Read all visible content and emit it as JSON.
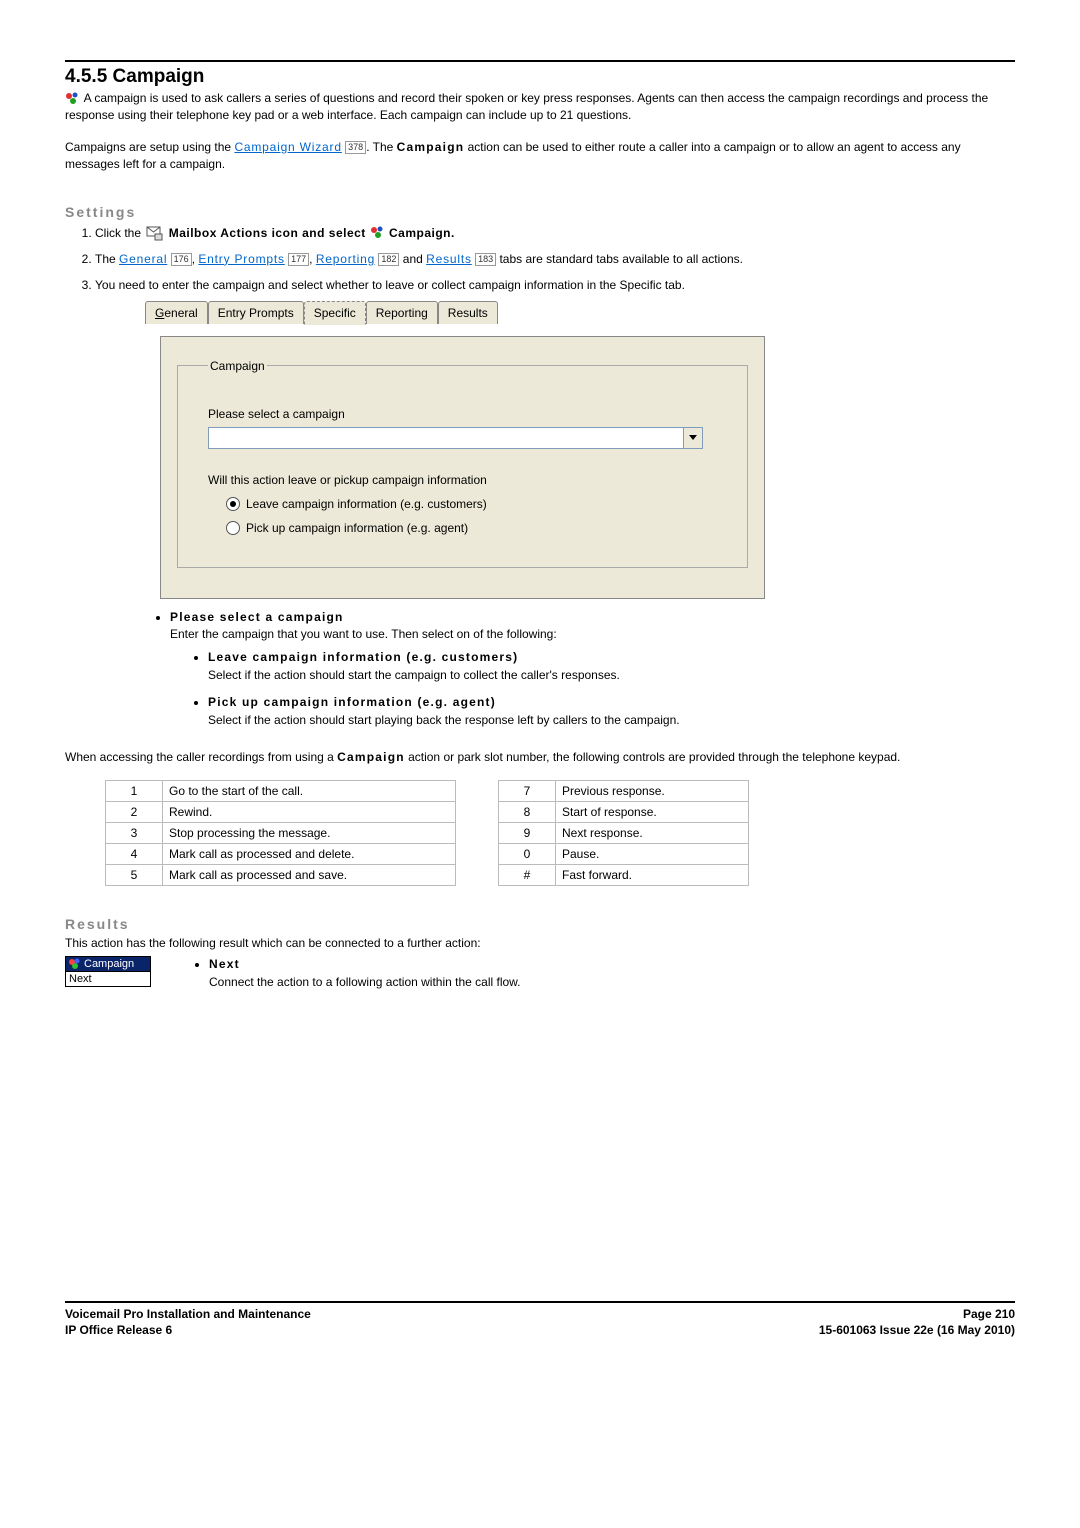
{
  "section": {
    "number_title": "4.5.5 Campaign",
    "intro1": "A campaign is used to ask callers a series of questions and record their spoken or key press responses. Agents can then access the campaign recordings and process the response using their telephone key pad or a web interface. Each campaign can include up to 21 questions.",
    "intro2a": "Campaigns are setup using the ",
    "intro2_link": "Campaign Wizard",
    "intro2_ref": "378",
    "intro2b": ". The ",
    "intro2_bold": "Campaign",
    "intro2c": " action can be used to either route a caller into a campaign or to allow an agent to access any messages left for a campaign."
  },
  "settings": {
    "heading": "Settings",
    "step1a": "Click the ",
    "step1b": " Mailbox Actions icon and select ",
    "step1c": " Campaign.",
    "step2a": "The ",
    "links": {
      "general": "General",
      "general_ref": "176",
      "entry": "Entry Prompts",
      "entry_ref": "177",
      "reporting": "Reporting",
      "reporting_ref": "182",
      "results": "Results",
      "results_ref": "183"
    },
    "step2b": " tabs are standard tabs available to all actions.",
    "step3": "You need to enter the campaign and select whether to leave or collect campaign information in the Specific tab."
  },
  "tabs": {
    "t0": "General",
    "t1": "Entry Prompts",
    "t2": "Specific",
    "t3": "Reporting",
    "t4": "Results"
  },
  "panel": {
    "legend": "Campaign",
    "select_label": "Please select a campaign",
    "question": "Will this action leave or pickup campaign information",
    "opt1": "Leave campaign information (e.g. customers)",
    "opt2": "Pick up campaign information (e.g. agent)"
  },
  "desc": {
    "please_select": "Please select a campaign",
    "please_select_body": "Enter the campaign that you want to use. Then select on of the following:",
    "leave_t": "Leave campaign information (e.g. customers)",
    "leave_b": "Select if the action should start the campaign to collect the caller's responses.",
    "pick_t": "Pick up campaign information (e.g. agent)",
    "pick_b": "Select if the action should start playing back the response left by callers to the campaign."
  },
  "keypad_intro_a": "When accessing the caller recordings from using a ",
  "keypad_intro_bold": "Campaign",
  "keypad_intro_b": " action or park slot number, the following controls are provided through the telephone keypad.",
  "keypad": {
    "r0": {
      "k1": "1",
      "d1": "Go to the start of the call.",
      "k2": "7",
      "d2": "Previous response."
    },
    "r1": {
      "k1": "2",
      "d1": "Rewind.",
      "k2": "8",
      "d2": "Start of response."
    },
    "r2": {
      "k1": "3",
      "d1": "Stop processing the message.",
      "k2": "9",
      "d2": "Next response."
    },
    "r3": {
      "k1": "4",
      "d1": "Mark call as processed and delete.",
      "k2": "0",
      "d2": "Pause."
    },
    "r4": {
      "k1": "5",
      "d1": "Mark call as processed and save.",
      "k2": "#",
      "d2": "Fast forward."
    }
  },
  "results": {
    "heading": "Results",
    "intro": "This action has the following result which can be connected to a further action:",
    "node_title": "Campaign",
    "node_item": "Next",
    "next_t": "Next",
    "next_b": "Connect the action to a following action within the call flow."
  },
  "footer": {
    "left1": "Voicemail Pro Installation and Maintenance",
    "left2": "IP Office Release 6",
    "right1": "Page 210",
    "right2": "15-601063 Issue 22e (16 May 2010)"
  }
}
